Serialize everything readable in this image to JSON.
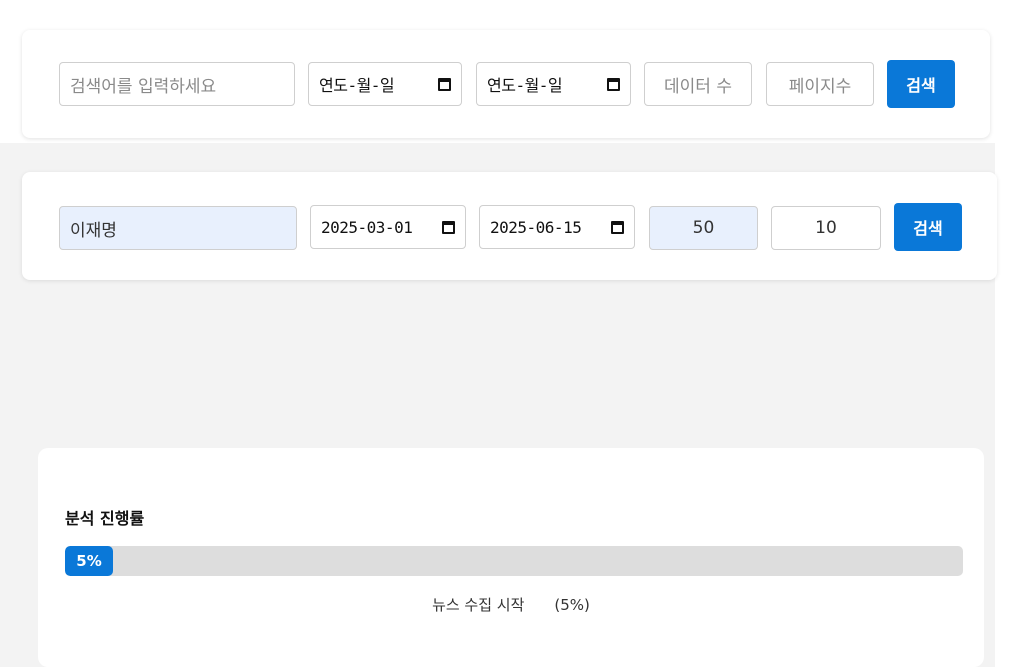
{
  "search_empty": {
    "keyword_placeholder": "검색어를 입력하세요",
    "start_date_placeholder": "연도-월-일",
    "end_date_placeholder": "연도-월-일",
    "count_placeholder": "데이터 수",
    "pages_placeholder": "페이지수",
    "search_label": "검색"
  },
  "search_filled": {
    "keyword_value": "이재명",
    "start_date_value": "2025-03-01",
    "end_date_value": "2025-06-15",
    "count_value": "50",
    "pages_value": "10",
    "search_label": "검색"
  },
  "progress": {
    "title": "분석 진행률",
    "percent": 5,
    "percent_label": "5%",
    "status_text": "뉴스 수집 시작",
    "status_percent": "(5%)"
  },
  "icons": {
    "calendar": "calendar-icon"
  },
  "colors": {
    "accent": "#0a78d8",
    "filled_field_bg": "#e8f0fd",
    "track": "#dddddd",
    "page_bg": "#f3f3f3"
  }
}
